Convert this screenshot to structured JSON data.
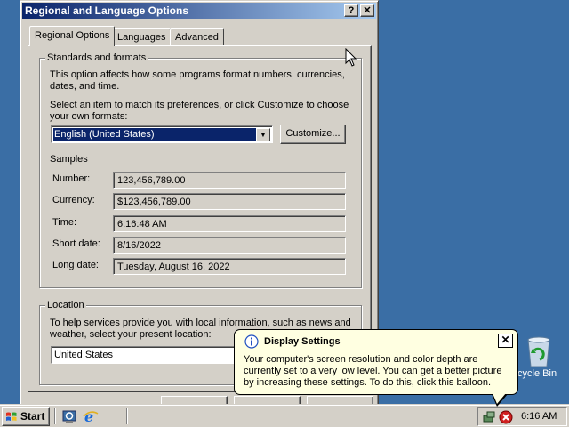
{
  "dialog": {
    "title": "Regional and Language Options",
    "help_btn": "?",
    "close_btn": "✕",
    "tabs": [
      "Regional Options",
      "Languages",
      "Advanced"
    ],
    "standards": {
      "group_title": "Standards and formats",
      "desc": "This option affects how some programs format numbers, currencies, dates, and time.",
      "select_prompt": "Select an item to match its preferences, or click Customize to choose your own formats:",
      "selected_locale": "English (United States)",
      "customize_label": "Customize...",
      "samples_label": "Samples",
      "samples": [
        {
          "label": "Number:",
          "value": "123,456,789.00"
        },
        {
          "label": "Currency:",
          "value": "$123,456,789.00"
        },
        {
          "label": "Time:",
          "value": "6:16:48 AM"
        },
        {
          "label": "Short date:",
          "value": "8/16/2022"
        },
        {
          "label": "Long date:",
          "value": "Tuesday, August 16, 2022"
        }
      ]
    },
    "location": {
      "group_title": "Location",
      "desc": "To help services provide you with local information, such as news and weather, select your present location:",
      "value": "United States"
    }
  },
  "balloon": {
    "title": "Display Settings",
    "body": "Your computer's screen resolution and color depth are currently set to a very low level. You can get a better picture by increasing these settings. To do this, click this balloon.",
    "close": "✕"
  },
  "desktop": {
    "recycle_label": "Recycle Bin"
  },
  "taskbar": {
    "start_label": "Start",
    "clock": "6:16 AM"
  },
  "colors": {
    "desktop": "#3a6ea5",
    "titlebar": "#0a246a",
    "face": "#d4d0c8",
    "balloon": "#ffffe1"
  }
}
